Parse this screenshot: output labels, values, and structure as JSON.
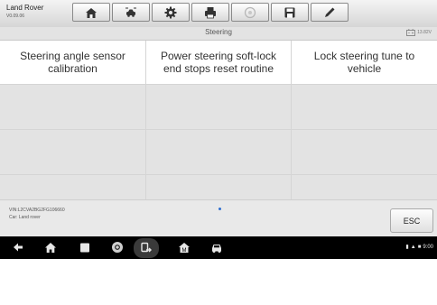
{
  "header": {
    "make": "Land Rover",
    "version": "V0.09.06",
    "tools": [
      {
        "name": "home-icon"
      },
      {
        "name": "vehicle-swap-icon"
      },
      {
        "name": "settings-icon"
      },
      {
        "name": "print-icon"
      },
      {
        "name": "help-icon"
      },
      {
        "name": "save-icon"
      },
      {
        "name": "edit-icon"
      }
    ]
  },
  "titlebar": {
    "title": "Steering",
    "voltage": "13.82V"
  },
  "functions": [
    {
      "label": "Steering angle sensor calibration"
    },
    {
      "label": "Power steering soft-lock end stops reset routine"
    },
    {
      "label": "Lock steering tune to vehicle"
    }
  ],
  "footer": {
    "vin": "VIN:L2CVA2BG2FG106660",
    "car": "Car: Land rover",
    "esc_label": "ESC"
  },
  "navbar": {
    "icons": [
      "back-icon",
      "home-icon",
      "recent-apps-icon",
      "chrome-icon",
      "connection-icon",
      "vci-icon",
      "car-icon"
    ],
    "clock": "9:00"
  },
  "colors": {
    "accent": "#2e6fd0",
    "grid_empty": "#e3e3e3",
    "navbar": "#000000"
  }
}
